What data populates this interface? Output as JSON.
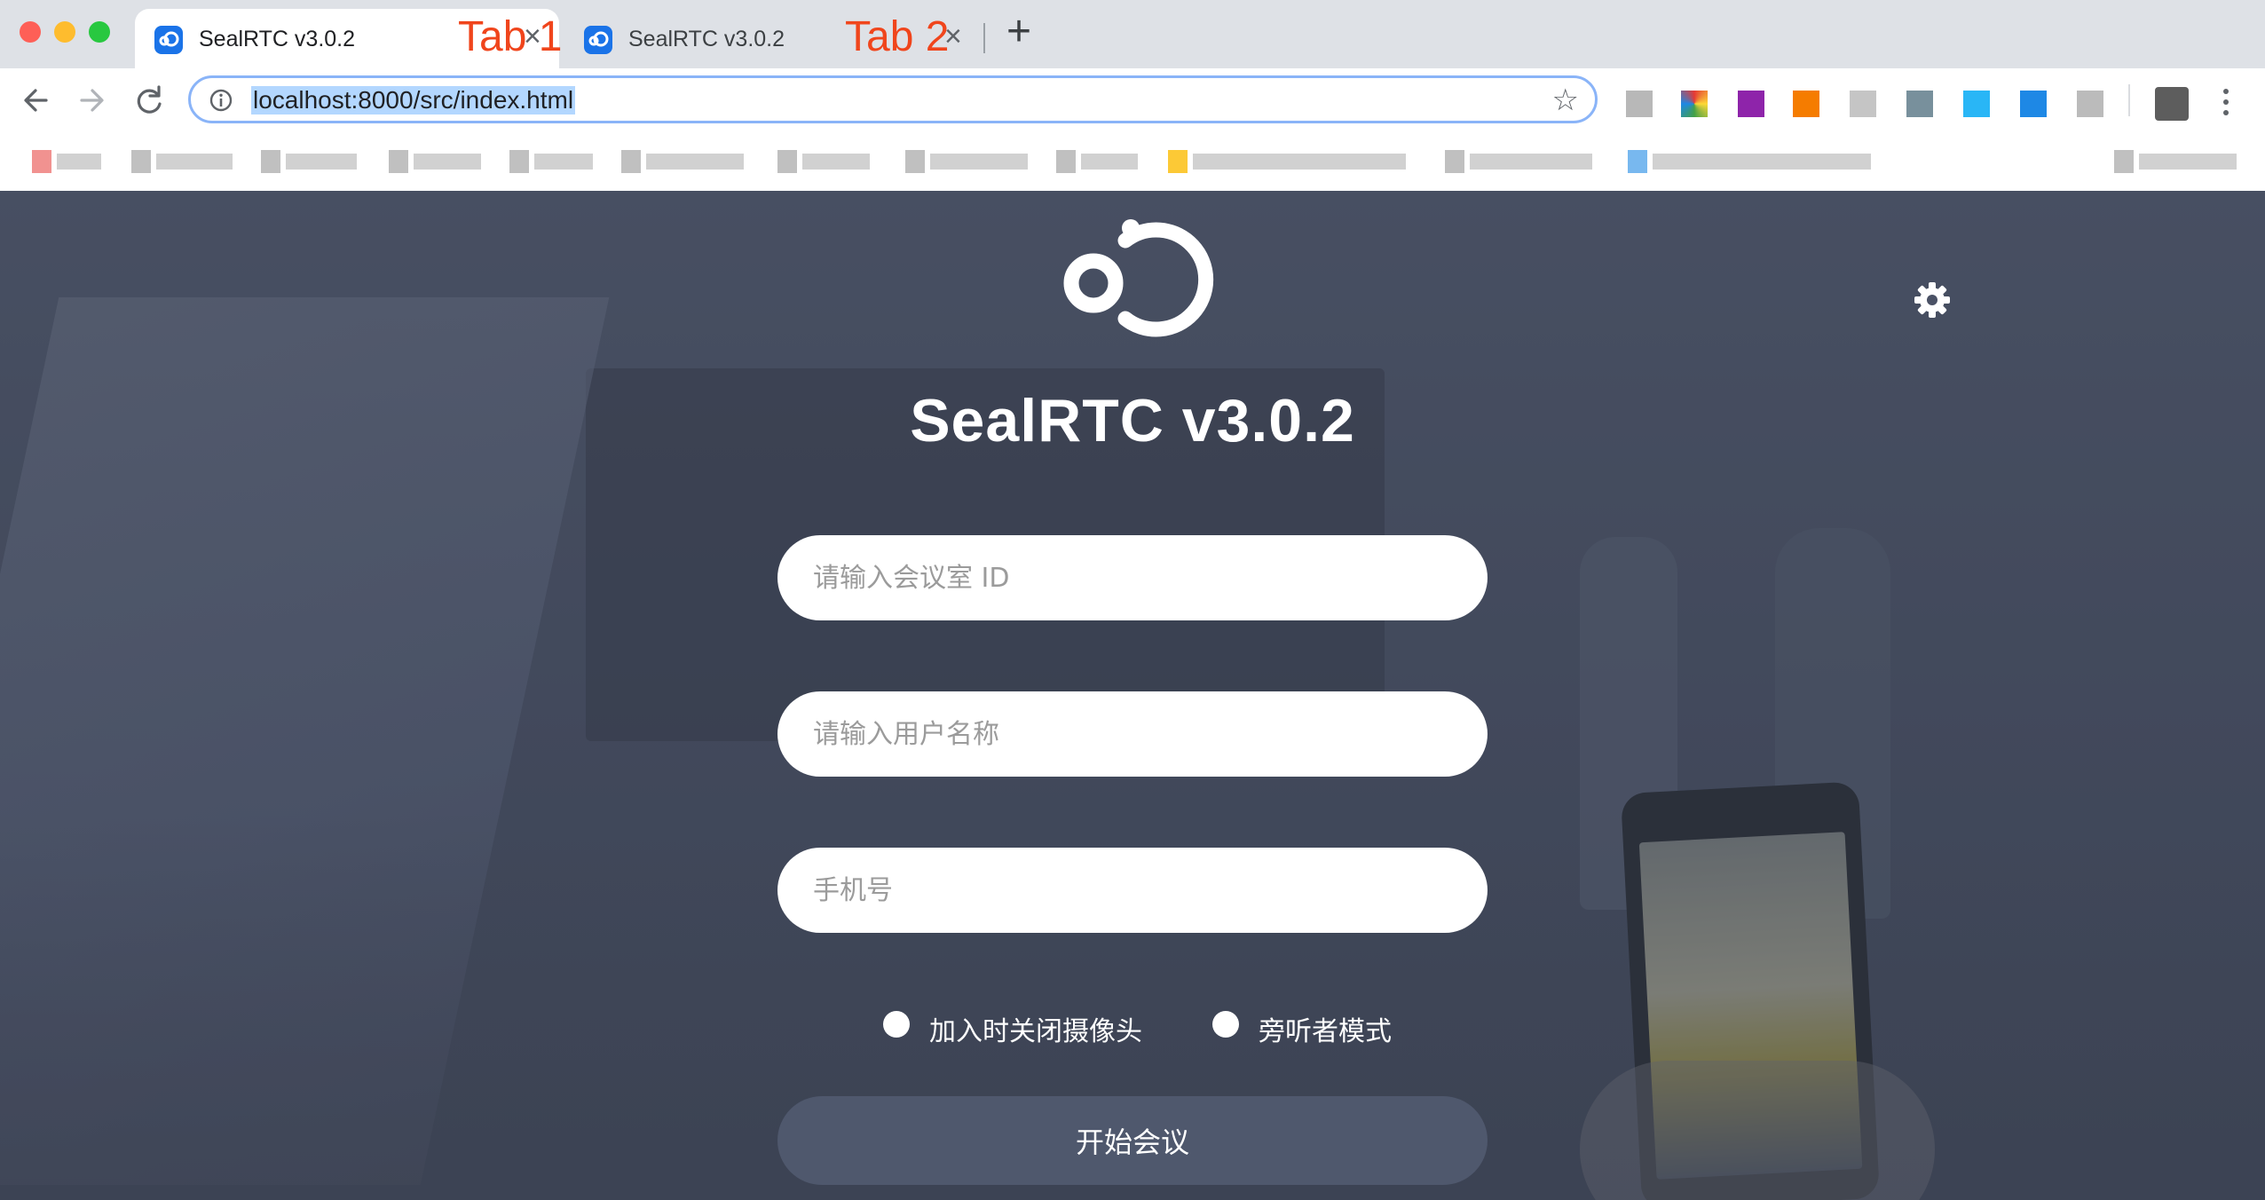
{
  "browser": {
    "tabs": [
      {
        "title": "SealRTC v3.0.2",
        "annotation": "Tab 1"
      },
      {
        "title": "SealRTC v3.0.2",
        "annotation": "Tab 2"
      }
    ],
    "address_url": "localhost:8000/src/index.html",
    "icons": {
      "close": "×",
      "new_tab": "+",
      "star": "☆"
    }
  },
  "page": {
    "app_title": "SealRTC v3.0.2",
    "fields": {
      "room_id_placeholder": "请输入会议室 ID",
      "username_placeholder": "请输入用户名称",
      "phone_placeholder": "手机号"
    },
    "options": {
      "close_camera_label": "加入时关闭摄像头",
      "observer_mode_label": "旁听者模式"
    },
    "start_button_label": "开始会议"
  },
  "colors": {
    "accent_blue": "#1a73e8",
    "annotation_orange": "#f0451c",
    "page_overlay": "#434a5d",
    "button_bg": "#4f586d"
  }
}
